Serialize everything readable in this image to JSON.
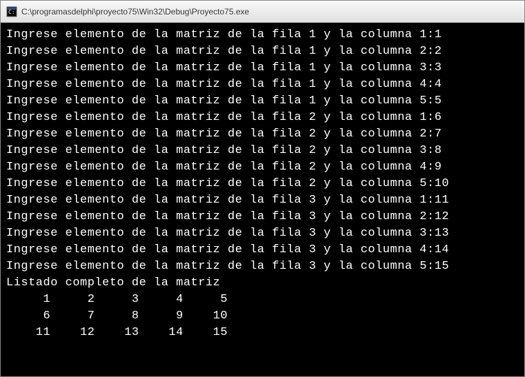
{
  "window": {
    "title": "C:\\programasdelphi\\proyecto75\\Win32\\Debug\\Proyecto75.exe"
  },
  "console": {
    "prompt_prefix": "Ingrese elemento de la matriz de la fila ",
    "prompt_mid": " y la columna ",
    "inputs": [
      {
        "row": 1,
        "col": 1,
        "value": 1
      },
      {
        "row": 1,
        "col": 2,
        "value": 2
      },
      {
        "row": 1,
        "col": 3,
        "value": 3
      },
      {
        "row": 1,
        "col": 4,
        "value": 4
      },
      {
        "row": 1,
        "col": 5,
        "value": 5
      },
      {
        "row": 2,
        "col": 1,
        "value": 6
      },
      {
        "row": 2,
        "col": 2,
        "value": 7
      },
      {
        "row": 2,
        "col": 3,
        "value": 8
      },
      {
        "row": 2,
        "col": 4,
        "value": 9
      },
      {
        "row": 2,
        "col": 5,
        "value": 10
      },
      {
        "row": 3,
        "col": 1,
        "value": 11
      },
      {
        "row": 3,
        "col": 2,
        "value": 12
      },
      {
        "row": 3,
        "col": 3,
        "value": 13
      },
      {
        "row": 3,
        "col": 4,
        "value": 14
      },
      {
        "row": 3,
        "col": 5,
        "value": 15
      }
    ],
    "listing_header": "Listado completo de la matriz",
    "matrix": [
      [
        1,
        2,
        3,
        4,
        5
      ],
      [
        6,
        7,
        8,
        9,
        10
      ],
      [
        11,
        12,
        13,
        14,
        15
      ]
    ]
  }
}
